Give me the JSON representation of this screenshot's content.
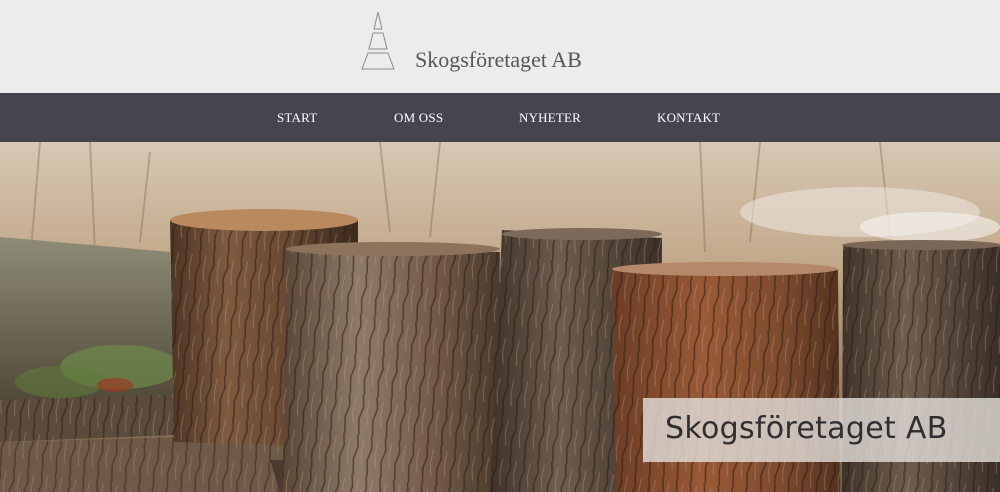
{
  "brand": {
    "name": "Skogsföretaget AB",
    "logo_icon": "tree-triangle-icon"
  },
  "nav": {
    "items": [
      {
        "label": "START"
      },
      {
        "label": "OM OSS"
      },
      {
        "label": "NYHETER"
      },
      {
        "label": "KONTAKT"
      }
    ]
  },
  "hero": {
    "image": "tree-stumps-photo",
    "caption": "Skogsföretaget AB"
  },
  "colors": {
    "header_bg": "#ececec",
    "nav_bg": "#45454f",
    "nav_text": "#ffffff",
    "brand_text": "#555659"
  }
}
